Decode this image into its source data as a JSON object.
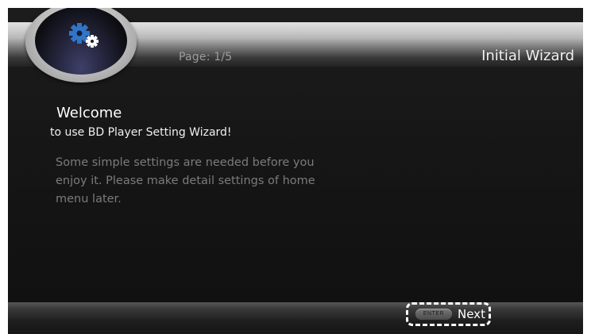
{
  "header": {
    "page_indicator": "Page: 1/5",
    "title": "Initial Wizard",
    "logo_icon": "settings-gears-icon"
  },
  "content": {
    "heading": "Welcome",
    "subtitle": "to use BD Player Setting Wizard!",
    "description": "Some simple settings are needed before you enjoy it. Please make detail settings of home menu later."
  },
  "footer": {
    "enter_key": "ENTER",
    "next_label": "Next"
  },
  "colors": {
    "gear_blue": "#2f76c9",
    "gear_white": "#ffffff",
    "focus_border": "#ffffff"
  }
}
